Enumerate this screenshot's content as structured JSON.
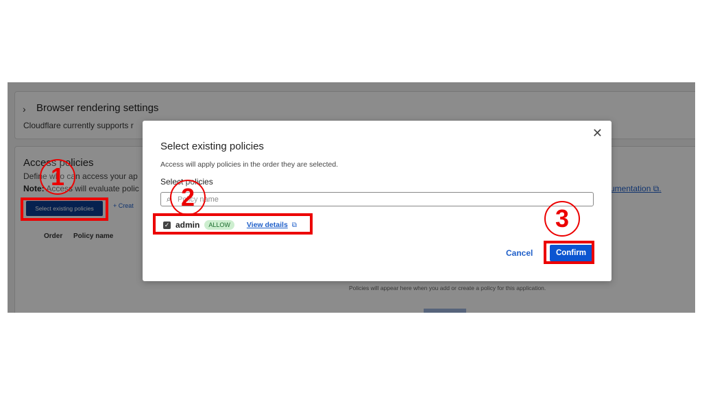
{
  "background": {
    "browser_rendering": {
      "title": "Browser rendering settings",
      "text": "Cloudflare currently supports r"
    },
    "access_policies": {
      "title": "Access policies",
      "description": "Define who can access your ap",
      "note_prefix": "Note:",
      "note": " Access will evaluate polic",
      "documentation_link": "cumentation",
      "select_button": "Select existing policies",
      "create_button": "+ Creat",
      "columns": [
        "Order",
        "Policy name"
      ],
      "empty_text": "Policies will appear here when you add or create a policy for this application."
    }
  },
  "modal": {
    "title": "Select existing policies",
    "description": "Access will apply policies in the order they are selected.",
    "select_label": "Select policies",
    "search_placeholder": "Policy name",
    "policies": [
      {
        "name": "admin",
        "badge": "ALLOW",
        "link": "View details",
        "checked": true
      }
    ],
    "cancel": "Cancel",
    "confirm": "Confirm"
  },
  "annotations": {
    "step1": "1",
    "step2": "2",
    "step3": "3"
  },
  "colors": {
    "highlight": "#ec0000",
    "primary_button": "#0b55d1",
    "link": "#1f5fc9",
    "allow_badge": "#cdeecf"
  },
  "icons": [
    "chevron-right-icon",
    "close-icon",
    "search-icon",
    "checkbox-checked-icon",
    "external-link-icon"
  ]
}
